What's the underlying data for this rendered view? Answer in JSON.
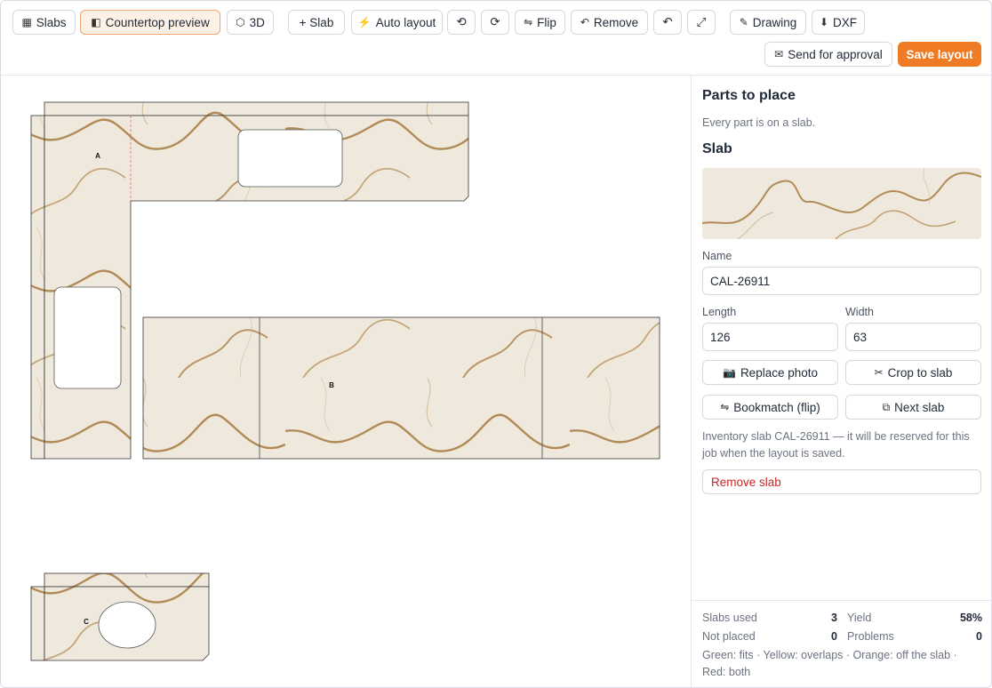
{
  "toolbar": {
    "slabs": "Slabs",
    "countertop_preview": "Countertop preview",
    "view_3d": "3D",
    "add_slab": "+ Slab",
    "auto_layout": "Auto layout",
    "rotate_ccw": "⟲",
    "rotate_cw": "⟳",
    "flip": "Flip",
    "remove": "Remove",
    "undo": "↶",
    "fullscreen": "⤢",
    "drawing": "Drawing",
    "dxf": "DXF",
    "send_for_approval": "Send for approval",
    "save_layout": "Save layout"
  },
  "canvas": {
    "part_labels": [
      "A",
      "B",
      "C"
    ]
  },
  "panel": {
    "parts_title": "Parts to place",
    "parts_status": "Every part is on a slab.",
    "slab_title": "Slab",
    "name_label": "Name",
    "name_value": "CAL-26911",
    "length_label": "Length",
    "length_value": "126",
    "width_label": "Width",
    "width_value": "63",
    "replace_photo": "Replace photo",
    "crop_to_slab": "Crop to slab",
    "bookmatch": "Bookmatch (flip)",
    "next_slab": "Next slab",
    "inventory_note": "Inventory slab CAL-26911 — it will be reserved for this job when the layout is saved.",
    "remove_slab": "Remove slab"
  },
  "stats": {
    "slabs_used_label": "Slabs used",
    "slabs_used_value": "3",
    "yield_label": "Yield",
    "yield_value": "58%",
    "not_placed_label": "Not placed",
    "not_placed_value": "0",
    "problems_label": "Problems",
    "problems_value": "0",
    "legend": "Green: fits · Yellow: overlaps · Orange: off the slab · Red: both"
  },
  "colors": {
    "accent": "#ef7c24",
    "danger": "#c62828",
    "marble_base": "#efe9dd",
    "marble_vein": "#a67a3f"
  }
}
